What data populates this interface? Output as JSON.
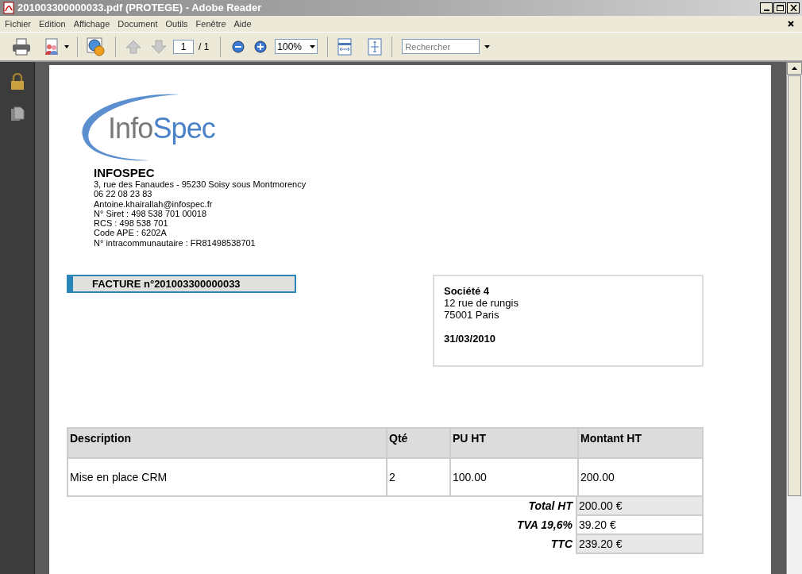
{
  "window": {
    "title": "201003300000033.pdf (PROTEGE) - Adobe Reader"
  },
  "menu": [
    "Fichier",
    "Edition",
    "Affichage",
    "Document",
    "Outils",
    "Fenêtre",
    "Aide"
  ],
  "toolbar": {
    "page_number": "1",
    "page_total": "/ 1",
    "zoom": "100%",
    "search": {
      "placeholder": "Rechercher"
    }
  },
  "document": {
    "logo": {
      "part_1": "Info",
      "part_2": "Spec"
    },
    "company": {
      "name": "INFOSPEC",
      "lines": [
        "3, rue des Fanaudes - 95230 Soisy sous Montmorency",
        "06 22 08 23 83",
        "Antoine.khairallah@infospec.fr",
        "N° Siret : 498 538 701 00018",
        "RCS : 498 538 701",
        "Code APE : 6202A",
        "N° intracommunautaire : FR81498538701"
      ]
    },
    "invoice_title": "FACTURE n°201003300000033",
    "customer": {
      "name": "Société 4",
      "lines": [
        "12 rue de rungis",
        "75001 Paris"
      ],
      "date": "31/03/2010"
    },
    "table": {
      "columns": [
        "Description",
        "Qté",
        "PU HT",
        "Montant HT"
      ],
      "rows": [
        [
          "Mise en place CRM",
          "2",
          "100.00",
          "200.00"
        ]
      ]
    },
    "totals": [
      {
        "label": "Total HT",
        "value": "200.00 €",
        "shaded": true
      },
      {
        "label": "TVA 19,6%",
        "value": "39.20 €",
        "shaded": false
      },
      {
        "label": "TTC",
        "value": "239.20 €",
        "shaded": true
      }
    ]
  }
}
